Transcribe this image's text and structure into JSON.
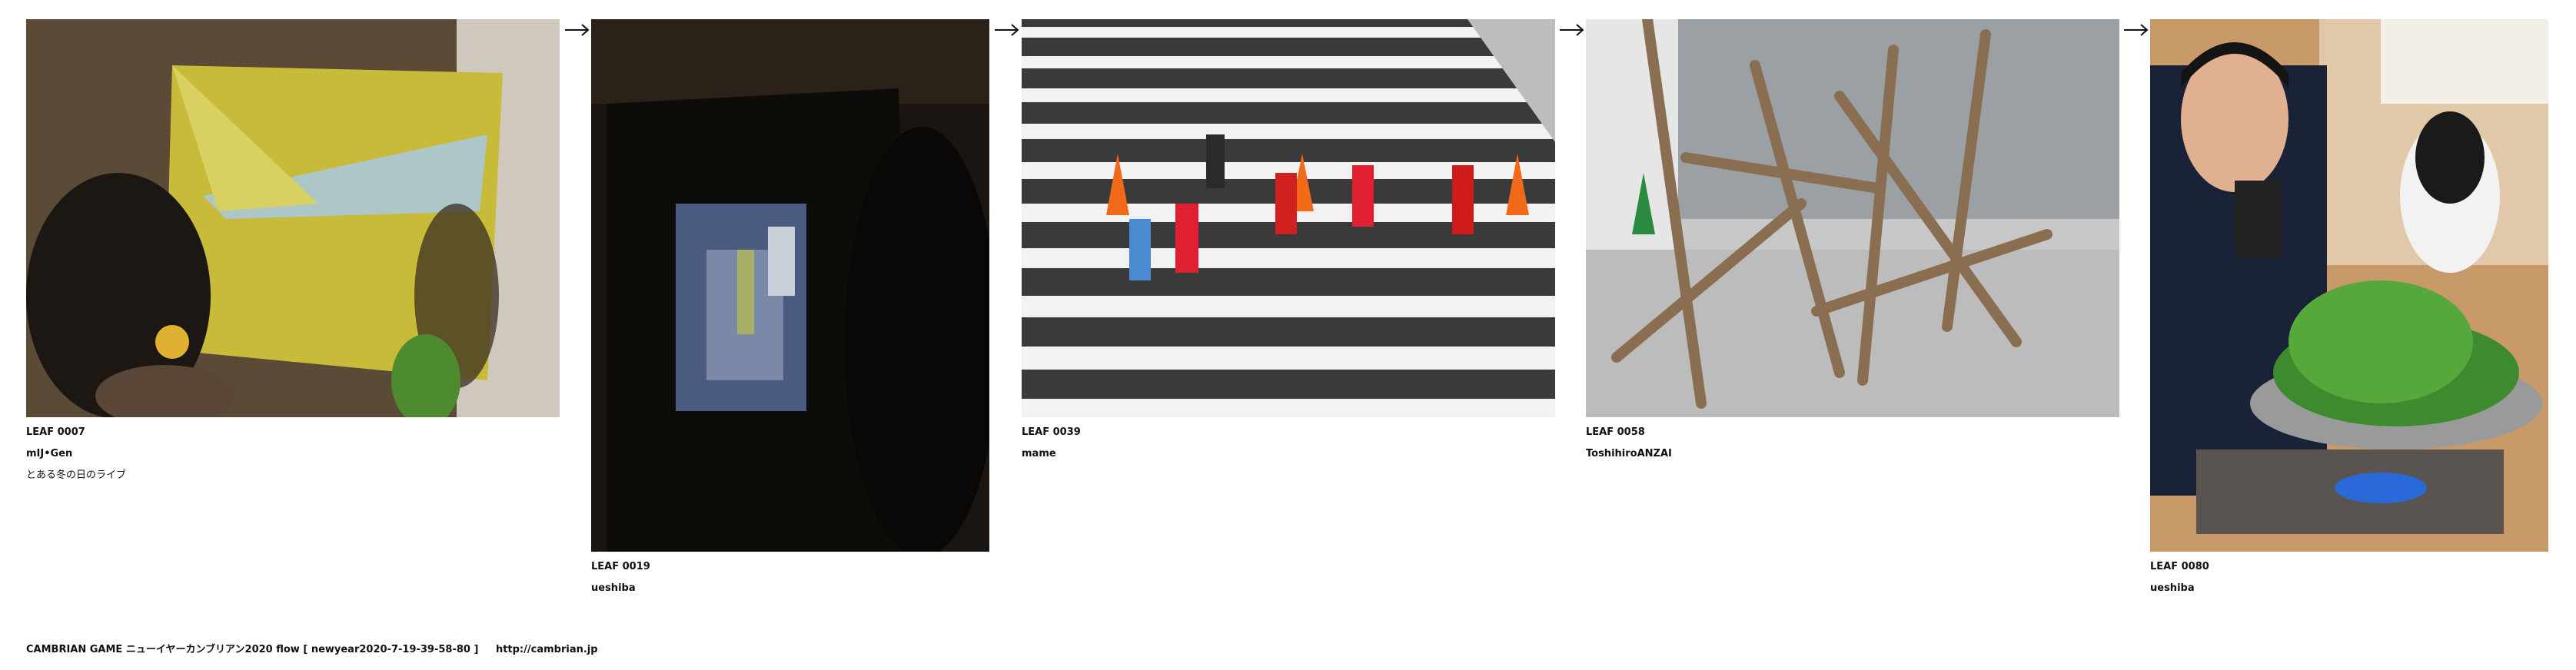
{
  "colors": {
    "text": "#111111",
    "background": "#ffffff"
  },
  "items": [
    {
      "id": "LEAF 0007",
      "author": "mIJ•Gen",
      "title": "とある冬の日のライブ",
      "scene": "projection-live-photo"
    },
    {
      "id": "LEAF 0019",
      "author": "ueshiba",
      "scene": "dark-exhibit-photo"
    },
    {
      "id": "LEAF 0039",
      "author": "mame",
      "scene": "runners-crosswalk-photo"
    },
    {
      "id": "LEAF 0058",
      "author": "ToshihiroANZAI",
      "scene": "driftwood-sculpture-photo"
    },
    {
      "id": "LEAF 0080",
      "author": "ueshiba",
      "scene": "hotpot-dinner-photo"
    }
  ],
  "arrows": [
    "arrow-right-icon",
    "arrow-right-icon",
    "arrow-right-icon",
    "arrow-right-icon"
  ],
  "footer": {
    "title": "CAMBRIAN GAME ニューイヤーカンブリアン2020 flow [ newyear2020-7-19-39-58-80 ]",
    "url": "http://cambrian.jp"
  }
}
